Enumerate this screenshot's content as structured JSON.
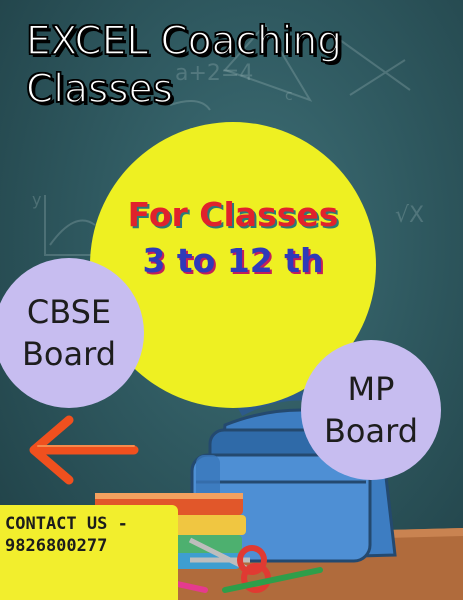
{
  "poster": {
    "title_line1": "EXCEL Coaching",
    "title_line2": "Classes",
    "headline_line1": "For Classes",
    "headline_line2": "3 to 12 th",
    "board_left": "CBSE\nBoard",
    "board_right": "MP\nBoard",
    "contact": "CONTACT US -\n9826800277"
  },
  "chalkboard_text": {
    "formula": "a+2=4",
    "letter_c": "c",
    "letter_y": "y",
    "root_x": "√X"
  },
  "icons": [
    "left-arrow-icon",
    "backpack-icon",
    "books-icon",
    "scissors-icon",
    "pencil-icon"
  ],
  "colors": {
    "background": "#2f5960",
    "circle": "#eef022",
    "bubble": "#c7bdf0",
    "arrow": "#f0501e",
    "contact_bg": "#f2ee2d",
    "headline_red": "#e0222c",
    "headline_blue": "#2f3ab8"
  }
}
